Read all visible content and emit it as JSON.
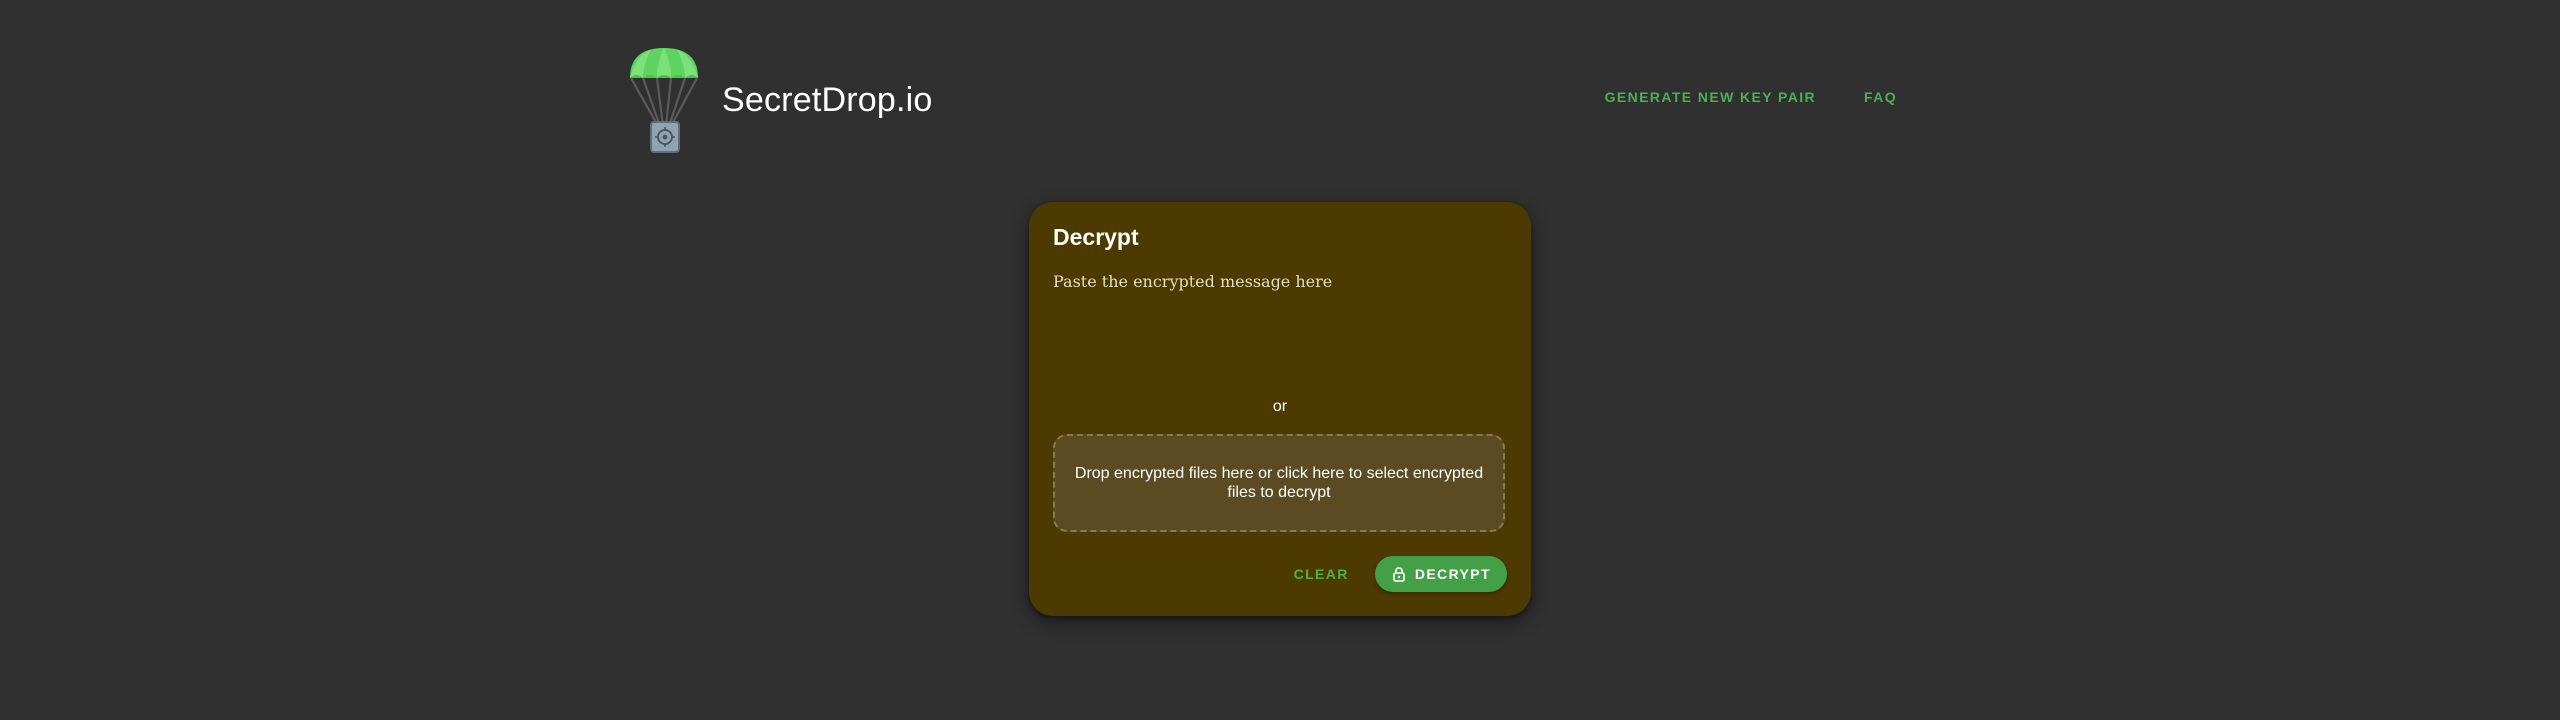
{
  "header": {
    "brand": "SecretDrop.io",
    "logo_icon": "parachute-safe-icon",
    "nav": [
      {
        "label": "GENERATE NEW KEY PAIR"
      },
      {
        "label": "FAQ"
      }
    ]
  },
  "card": {
    "title": "Decrypt",
    "message_placeholder": "Paste the encrypted message here",
    "message_value": "",
    "or_label": "or",
    "dropzone_text": "Drop encrypted files here or click here to select encrypted files to decrypt",
    "clear_label": "CLEAR",
    "decrypt_label": "DECRYPT",
    "decrypt_icon": "lock-open-icon"
  },
  "colors": {
    "background": "#303030",
    "card": "#4d3a00",
    "accent": "#4caf50",
    "button": "#43a047"
  }
}
